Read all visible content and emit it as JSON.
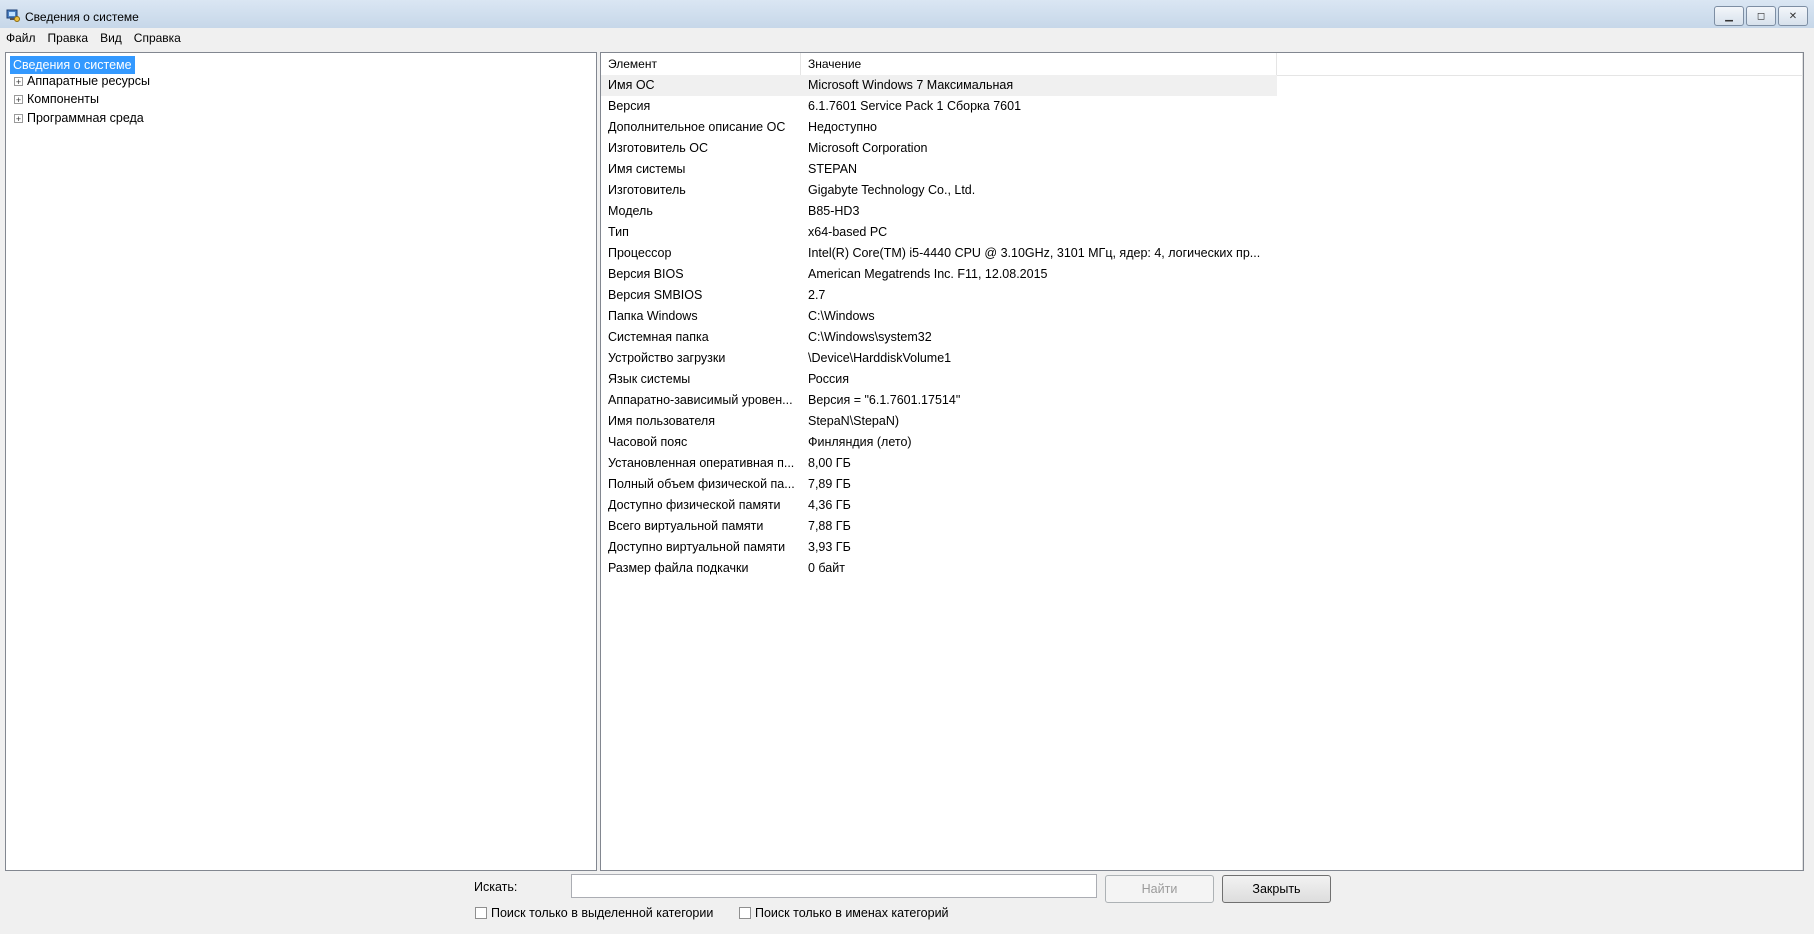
{
  "window": {
    "title": "Сведения о системе",
    "controls": {
      "minimize": "▁",
      "maximize": "◻",
      "close": "✕"
    }
  },
  "menu": [
    "Файл",
    "Правка",
    "Вид",
    "Справка"
  ],
  "tree": {
    "root": "Сведения о системе",
    "nodes": [
      "Аппаратные ресурсы",
      "Компоненты",
      "Программная среда"
    ],
    "expander_glyph": "+"
  },
  "list": {
    "headers": {
      "element": "Элемент",
      "value": "Значение"
    },
    "rows": [
      [
        "Имя ОС",
        "Microsoft Windows 7 Максимальная"
      ],
      [
        "Версия",
        "6.1.7601 Service Pack 1 Сборка 7601"
      ],
      [
        "Дополнительное описание ОС",
        "Недоступно"
      ],
      [
        "Изготовитель ОС",
        "Microsoft Corporation"
      ],
      [
        "Имя системы",
        "STEPAN"
      ],
      [
        "Изготовитель",
        "Gigabyte Technology Co., Ltd."
      ],
      [
        "Модель",
        "B85-HD3"
      ],
      [
        "Тип",
        "x64-based PC"
      ],
      [
        "Процессор",
        "Intel(R) Core(TM) i5-4440 CPU @ 3.10GHz, 3101 МГц, ядер: 4, логических пр..."
      ],
      [
        "Версия BIOS",
        "American Megatrends Inc. F11, 12.08.2015"
      ],
      [
        "Версия SMBIOS",
        "2.7"
      ],
      [
        "Папка Windows",
        "C:\\Windows"
      ],
      [
        "Системная папка",
        "C:\\Windows\\system32"
      ],
      [
        "Устройство загрузки",
        "\\Device\\HarddiskVolume1"
      ],
      [
        "Язык системы",
        "Россия"
      ],
      [
        "Аппаратно-зависимый уровен...",
        "Версия = \"6.1.7601.17514\""
      ],
      [
        "Имя пользователя",
        "StepaN\\StepaN)"
      ],
      [
        "Часовой пояс",
        "Финляндия (лето)"
      ],
      [
        "Установленная оперативная п...",
        "8,00 ГБ"
      ],
      [
        "Полный объем физической па...",
        "7,89 ГБ"
      ],
      [
        "Доступно физической памяти",
        "4,36 ГБ"
      ],
      [
        "Всего виртуальной памяти",
        "7,88 ГБ"
      ],
      [
        "Доступно виртуальной памяти",
        "3,93 ГБ"
      ],
      [
        "Размер файла подкачки",
        "0 байт"
      ]
    ]
  },
  "search": {
    "label": "Искать:",
    "value": "",
    "find_button": "Найти",
    "close_button": "Закрыть",
    "chk_selected_category": "Поиск только в выделенной категории",
    "chk_category_names": "Поиск только в именах категорий"
  }
}
